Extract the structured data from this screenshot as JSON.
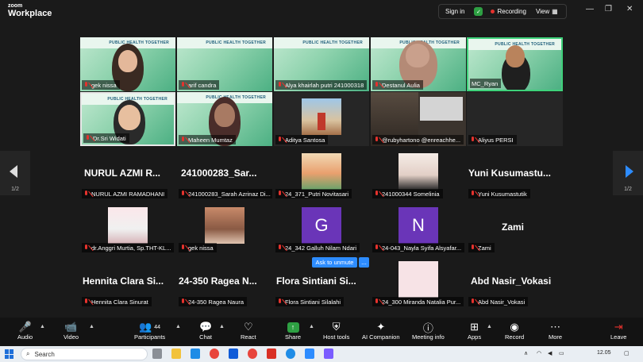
{
  "app": {
    "logo_small": "zoom",
    "logo_big": "Workplace",
    "signin": "Sign in",
    "recording": "Recording",
    "view": "View"
  },
  "top_tiles": [
    {
      "name": "gek nissa"
    },
    {
      "name": "arif candra"
    },
    {
      "name": "Alya khairlah putri 241000318"
    },
    {
      "name": "Destanul Aulia"
    },
    {
      "name": "MC_Ryan"
    },
    {
      "name": "Dr.Sri Widati"
    },
    {
      "name": "Maheen Mumtaz"
    },
    {
      "name": "Aditya Santosa"
    },
    {
      "name": "@rubyhartono @enreachhe..."
    },
    {
      "name": "Aliyus PERSI"
    }
  ],
  "slide_header": "PUBLIC HEALTH TOGETHER",
  "grid_rows": [
    [
      {
        "big": "NURUL AZMI R...",
        "label": "NURUL AZMI RAMADHANI"
      },
      {
        "big": "241000283_Sar...",
        "label": "241000283_Sarah Azrinaz Di..."
      },
      {
        "big": "",
        "label": "24_371_Putri Novitasari"
      },
      {
        "big": "",
        "label": "241000344 Somelinia"
      },
      {
        "big": "Yuni Kusumastu...",
        "label": "Yuni Kusumastutik"
      }
    ],
    [
      {
        "big": "",
        "label": "dr.Anggri Murtia, Sp.THT-KL..."
      },
      {
        "big": "",
        "label": "gek nissa"
      },
      {
        "big": "G",
        "label": "24_342 Galluh Nilam Ndari"
      },
      {
        "big": "N",
        "label": "24-043_Nayla Syifa Alsyafar..."
      },
      {
        "big": "Zami",
        "label": "Zami"
      }
    ],
    [
      {
        "big": "Hennita Clara Si...",
        "label": "Hennita Clara Sinurat"
      },
      {
        "big": "24-350 Ragea N...",
        "label": "24-350 Ragea Naura"
      },
      {
        "big": "Flora Sintiani Si...",
        "label": "Flora Sintiani Silalahi"
      },
      {
        "big": "",
        "label": "24_300 Miranda Natalia Pur..."
      },
      {
        "big": "Abd Nasir_Vokasi",
        "label": "Abd Nasir_Vokasi"
      }
    ]
  ],
  "unmute_btn": "Ask to unmute",
  "more_btn": "...",
  "page_left": "1/2",
  "page_right": "1/2",
  "toolbar": {
    "audio": "Audio",
    "video": "Video",
    "participants": "Participants",
    "participants_count": "44",
    "chat": "Chat",
    "react": "React",
    "share": "Share",
    "host_tools": "Host tools",
    "ai_companion": "AI Companion",
    "meeting_info": "Meeting info",
    "apps": "Apps",
    "record": "Record",
    "more": "More",
    "leave": "Leave"
  },
  "taskbar": {
    "search": "Search",
    "time": "12.05"
  },
  "colors": {
    "accent": "#2d8cff",
    "record_red": "#e5322d",
    "avatar_purple": "#6a35b8"
  }
}
